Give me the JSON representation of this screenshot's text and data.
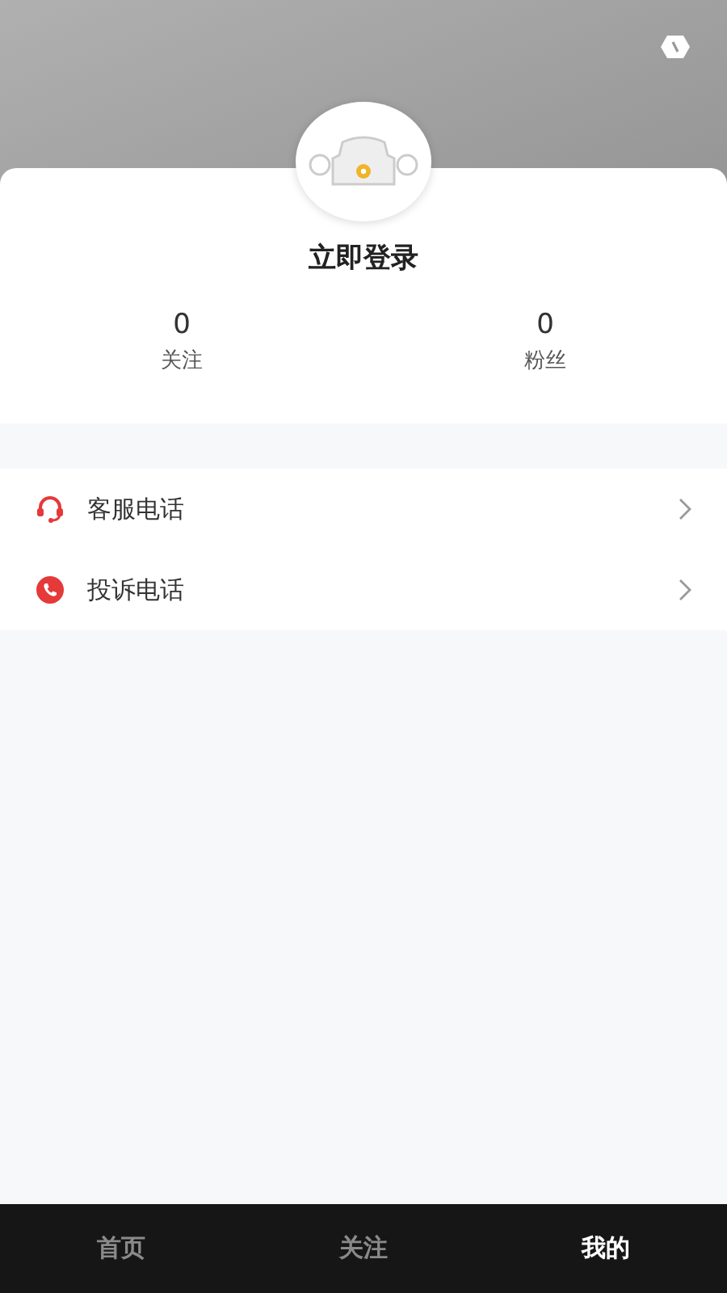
{
  "profile": {
    "login_label": "立即登录"
  },
  "stats": [
    {
      "value": "0",
      "label": "关注"
    },
    {
      "value": "0",
      "label": "粉丝"
    }
  ],
  "menu": [
    {
      "kind": "headset",
      "label": "客服电话"
    },
    {
      "kind": "phone",
      "label": "投诉电话"
    }
  ],
  "tabs": [
    {
      "label": "首页",
      "selected": false
    },
    {
      "label": "关注",
      "selected": false
    },
    {
      "label": "我的",
      "selected": true
    }
  ]
}
